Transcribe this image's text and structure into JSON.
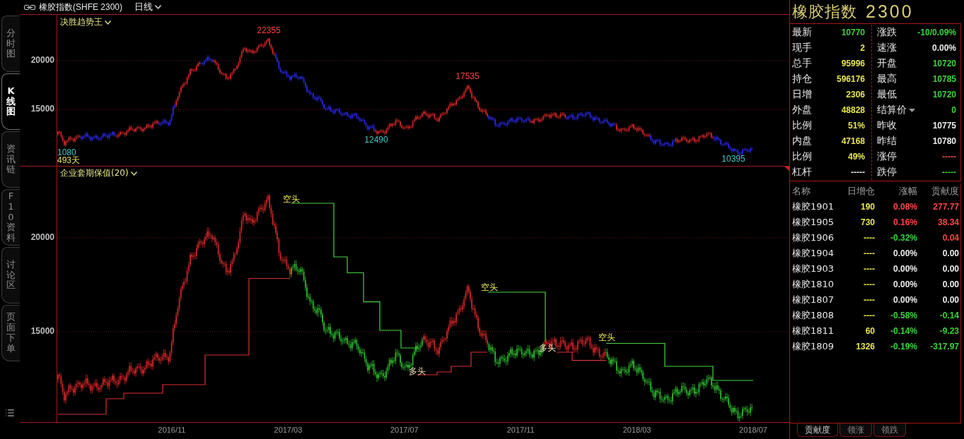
{
  "header": {
    "title": "橡胶指数(SHFE 2300)",
    "period": "日线"
  },
  "side_tabs": [
    {
      "label": "分时图",
      "selected": false
    },
    {
      "label": "K线图",
      "selected": true
    },
    {
      "label": "资讯链",
      "selected": false
    },
    {
      "label": "F10资料",
      "selected": false
    },
    {
      "label": "讨论区",
      "selected": false
    },
    {
      "label": "页面下单",
      "selected": false
    }
  ],
  "trend_panel": {
    "title": "决胜趋势王",
    "y_axis": [
      "20000",
      "15000"
    ],
    "annotations": [
      {
        "kind": "high",
        "text": "22355"
      },
      {
        "kind": "high",
        "text": "17535"
      },
      {
        "kind": "low",
        "text": "12490"
      },
      {
        "kind": "low",
        "text": "10395"
      },
      {
        "kind": "count",
        "text": "1080"
      },
      {
        "kind": "days",
        "text": "493天"
      }
    ]
  },
  "hedge_panel": {
    "title": "企业套期保值(20)",
    "y_axis": [
      "20000",
      "15000"
    ],
    "annotations": [
      {
        "kind": "short",
        "text": "空头"
      },
      {
        "kind": "long",
        "text": "多头"
      },
      {
        "kind": "short",
        "text": "空头"
      },
      {
        "kind": "long",
        "text": "多头"
      },
      {
        "kind": "short",
        "text": "空头"
      }
    ]
  },
  "x_axis": [
    "2016/11",
    "2017/03",
    "2017/07",
    "2017/11",
    "2018/03",
    "2018/07"
  ],
  "quote": {
    "name": "橡胶指数",
    "code": "2300",
    "left": [
      {
        "label": "最新",
        "value": "10770",
        "color": "#3cd23c"
      },
      {
        "label": "现手",
        "value": "2",
        "color": "#e6e650"
      },
      {
        "label": "总手",
        "value": "95996",
        "color": "#e6e650"
      },
      {
        "label": "持仓",
        "value": "596176",
        "color": "#e6e650"
      },
      {
        "label": "日增",
        "value": "2306",
        "color": "#e6e650"
      },
      {
        "label": "外盘",
        "value": "48828",
        "color": "#e6e650"
      },
      {
        "label": "比例",
        "value": "51%",
        "color": "#e6e650"
      },
      {
        "label": "内盘",
        "value": "47168",
        "color": "#e6e650"
      },
      {
        "label": "比例",
        "value": "49%",
        "color": "#e6e650"
      },
      {
        "label": "杠杆",
        "value": "-----",
        "color": "#ececec"
      }
    ],
    "right": [
      {
        "kind": "plain",
        "label": "涨跌",
        "value": "-10/0.09%",
        "color": "#3cd23c"
      },
      {
        "kind": "plain",
        "label": "速涨",
        "value": "0.00%",
        "color": "#ececec"
      },
      {
        "kind": "plain",
        "label": "开盘",
        "value": "10720",
        "color": "#3cd23c"
      },
      {
        "kind": "plain",
        "label": "最高",
        "value": "10785",
        "color": "#3cd23c"
      },
      {
        "kind": "plain",
        "label": "最低",
        "value": "10720",
        "color": "#3cd23c"
      },
      {
        "kind": "dropdown",
        "label": "结算价",
        "value": "0",
        "color": "#3cd23c"
      },
      {
        "kind": "plain",
        "label": "昨收",
        "value": "10775",
        "color": "#ececec"
      },
      {
        "kind": "plain",
        "label": "昨结",
        "value": "10780",
        "color": "#ececec"
      },
      {
        "kind": "plain",
        "label": "涨停",
        "value": "-----",
        "color": "#ff4646"
      },
      {
        "kind": "plain",
        "label": "跌停",
        "value": "-----",
        "color": "#3cd23c"
      }
    ]
  },
  "contracts": {
    "columns": [
      "名称",
      "日增仓",
      "涨幅",
      "贡献度"
    ],
    "rows": [
      {
        "name": "橡胶1901",
        "oi_change": "190",
        "change": {
          "text": "0.08%",
          "color": "#ff4646"
        },
        "contribution": {
          "text": "277.77",
          "color": "#ff4646"
        }
      },
      {
        "name": "橡胶1905",
        "oi_change": "730",
        "change": {
          "text": "0.16%",
          "color": "#ff4646"
        },
        "contribution": {
          "text": "38.34",
          "color": "#ff4646"
        }
      },
      {
        "name": "橡胶1906",
        "oi_change": "----",
        "change": {
          "text": "-0.32%",
          "color": "#3cd23c"
        },
        "contribution": {
          "text": "0.04",
          "color": "#ff4646"
        }
      },
      {
        "name": "橡胶1904",
        "oi_change": "----",
        "change": {
          "text": "0.00%",
          "color": "#ececec"
        },
        "contribution": {
          "text": "0.00",
          "color": "#ececec"
        }
      },
      {
        "name": "橡胶1903",
        "oi_change": "----",
        "change": {
          "text": "0.00%",
          "color": "#ececec"
        },
        "contribution": {
          "text": "0.00",
          "color": "#ececec"
        }
      },
      {
        "name": "橡胶1810",
        "oi_change": "----",
        "change": {
          "text": "0.00%",
          "color": "#ececec"
        },
        "contribution": {
          "text": "0.00",
          "color": "#ececec"
        }
      },
      {
        "name": "橡胶1807",
        "oi_change": "----",
        "change": {
          "text": "0.00%",
          "color": "#ececec"
        },
        "contribution": {
          "text": "0.00",
          "color": "#ececec"
        }
      },
      {
        "name": "橡胶1808",
        "oi_change": "----",
        "change": {
          "text": "-0.58%",
          "color": "#3cd23c"
        },
        "contribution": {
          "text": "-0.14",
          "color": "#3cd23c"
        }
      },
      {
        "name": "橡胶1811",
        "oi_change": "60",
        "change": {
          "text": "-0.14%",
          "color": "#3cd23c"
        },
        "contribution": {
          "text": "-9.23",
          "color": "#3cd23c"
        }
      },
      {
        "name": "橡胶1809",
        "oi_change": "1326",
        "change": {
          "text": "-0.19%",
          "color": "#3cd23c"
        },
        "contribution": {
          "text": "-317.97",
          "color": "#3cd23c"
        }
      }
    ]
  },
  "bottom_tabs": [
    {
      "label": "贡献度",
      "selected": true
    },
    {
      "label": "领涨",
      "selected": false
    },
    {
      "label": "领跌",
      "selected": false
    }
  ]
}
